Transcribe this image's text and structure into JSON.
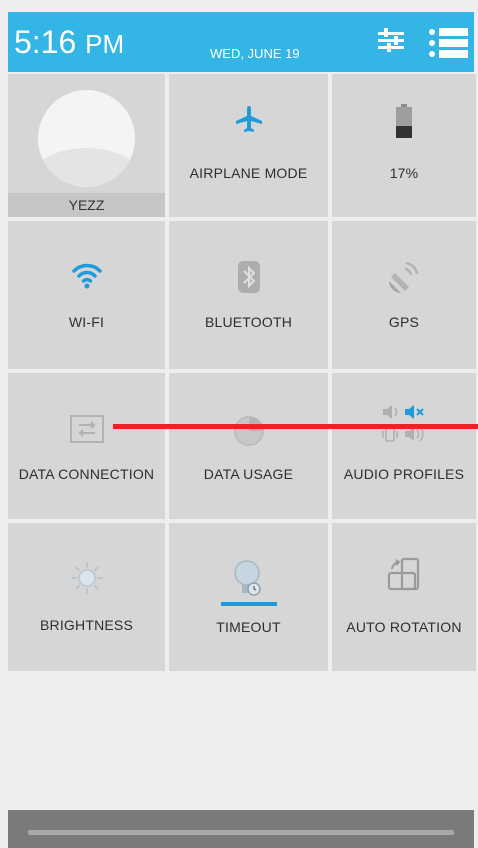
{
  "status_bar": {
    "time": "5:16",
    "ampm": "PM",
    "date": "WED, JUNE 19",
    "icons": [
      "settings-sliders-icon",
      "list-view-icon"
    ]
  },
  "tiles": {
    "user": {
      "name": "YEZZ",
      "icon": "user-avatar-icon"
    },
    "airplane": {
      "label": "AIRPLANE MODE",
      "icon": "airplane-icon"
    },
    "battery": {
      "label": "17%",
      "icon": "battery-icon"
    },
    "wifi": {
      "label": "WI-FI",
      "icon": "wifi-icon"
    },
    "bluetooth": {
      "label": "BLUETOOTH",
      "icon": "bluetooth-icon"
    },
    "gps": {
      "label": "GPS",
      "icon": "gps-satellite-icon"
    },
    "data_connection": {
      "label": "DATA CONNECTION",
      "icon": "data-connection-icon"
    },
    "data_usage": {
      "label": "DATA USAGE",
      "icon": "data-usage-icon"
    },
    "audio_profiles": {
      "label": "AUDIO PROFILES",
      "icon": "audio-profiles-icon"
    },
    "brightness": {
      "label": "BRIGHTNESS",
      "icon": "brightness-icon"
    },
    "timeout": {
      "label": "TIMEOUT",
      "icon": "timeout-bulb-icon"
    },
    "auto_rotation": {
      "label": "AUTO ROTATION",
      "icon": "auto-rotation-icon"
    }
  },
  "colors": {
    "accent": "#33b5e5",
    "tile_bg": "#d6d6d6",
    "annotation_line": "#ee2222"
  }
}
